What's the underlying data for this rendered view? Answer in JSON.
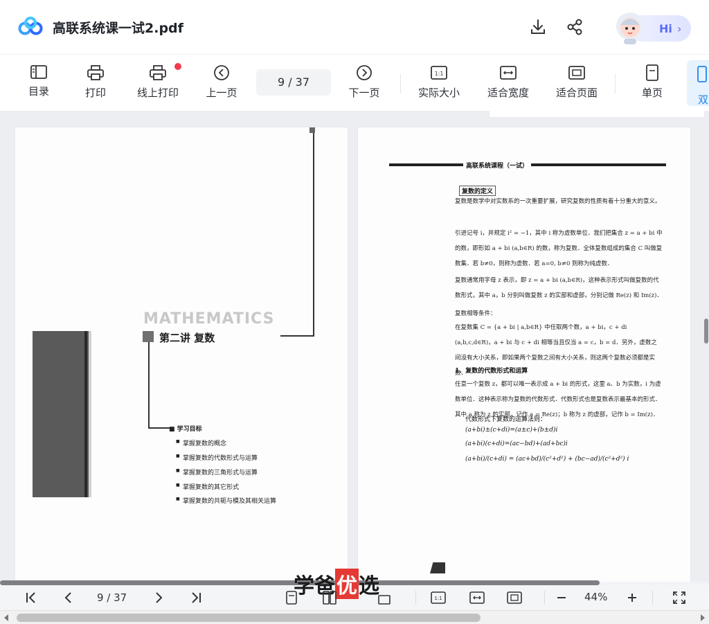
{
  "header": {
    "title": "高联系统课一试2.pdf",
    "assistant_label": "Hi",
    "accent": "#5b6cf5"
  },
  "toolbar": {
    "toc": "目录",
    "print": "打印",
    "online_print": "线上打印",
    "prev_page": "上一页",
    "page_indicator": "9  / 37",
    "next_page": "下一页",
    "actual_size": "实际大小",
    "fit_width": "适合宽度",
    "fit_page": "适合页面",
    "single_page": "单页",
    "dual_page": "双"
  },
  "left_page": {
    "watermark_word": "MATHEMATICS",
    "lecture_title": "第二讲   复数",
    "goals_heading": "学习目标",
    "goals": [
      "掌握复数的概念",
      "掌握复数的代数形式与运算",
      "掌握复数的三角形式与运算",
      "掌握复数的其它形式",
      "掌握复数的共轭与模及其相关运算"
    ]
  },
  "right_page": {
    "running_head": "高联系统课程（一试）",
    "def_heading": "复数的定义",
    "para1": "复数是数学中对实数系的一次重要扩展，研究复数的性质有着十分重大的意义。",
    "para2": "引进记号 i，并规定 i² = −1，其中 i 称为虚数单位．我们把集合 z = a + bi 中的数，即形如 a + bi (a,b∈R) 的数，称为复数．全体复数组成的集合 C 叫做复数集．若 b≠0，则称为虚数．若 a=0, b≠0 则称为纯虚数．",
    "para3": "复数通常用字母 z 表示，即 z = a + bi (a,b∈R)，这种表示形式叫做复数的代数形式，其中 a，b 分别叫做复数 z 的实部和虚部，分别记做 Re(z) 和 Im(z)．",
    "eq_heading": "复数相等条件：",
    "para4": "在复数集 C = {a + bi | a,b∈R} 中任取两个数，a + bi，c + di (a,b,c,d∈R)，a + bi 与 c + di 相等当且仅当 a = c，b = d．另外，虚数之间没有大小关系，即如果两个复数之间有大小关系，则这两个复数必须都是实数．",
    "sec1_heading": "1、复数的代数形式和运算",
    "para5": "任意一个复数 z，都可以唯一表示成 a + bi 的形式，这里 a、b 为实数，i 为虚数单位．这种表示称为复数的代数形式．代数形式也是复数表示最基本的形式．其中 a 称为 z 的实部，记作 a = Re(z)；b 称为 z 的虚部，记作 b = Im(z)．",
    "ops_heading": "代数形式下复数的运算法则：",
    "formulas": [
      "(a+bi)±(c+di)=(a±c)+(b±d)i",
      "(a+bi)(c+di)=(ac−bd)+(ad+bc)i",
      "(a+bi)/(c+di) = (ac+bd)/(c²+d²) + (bc−ad)/(c²+d²) i"
    ]
  },
  "bottombar": {
    "page_indicator": "9  / 37",
    "zoom": "44%",
    "brand_pre": "学爸",
    "brand_highlight": "优",
    "brand_post": "选"
  }
}
